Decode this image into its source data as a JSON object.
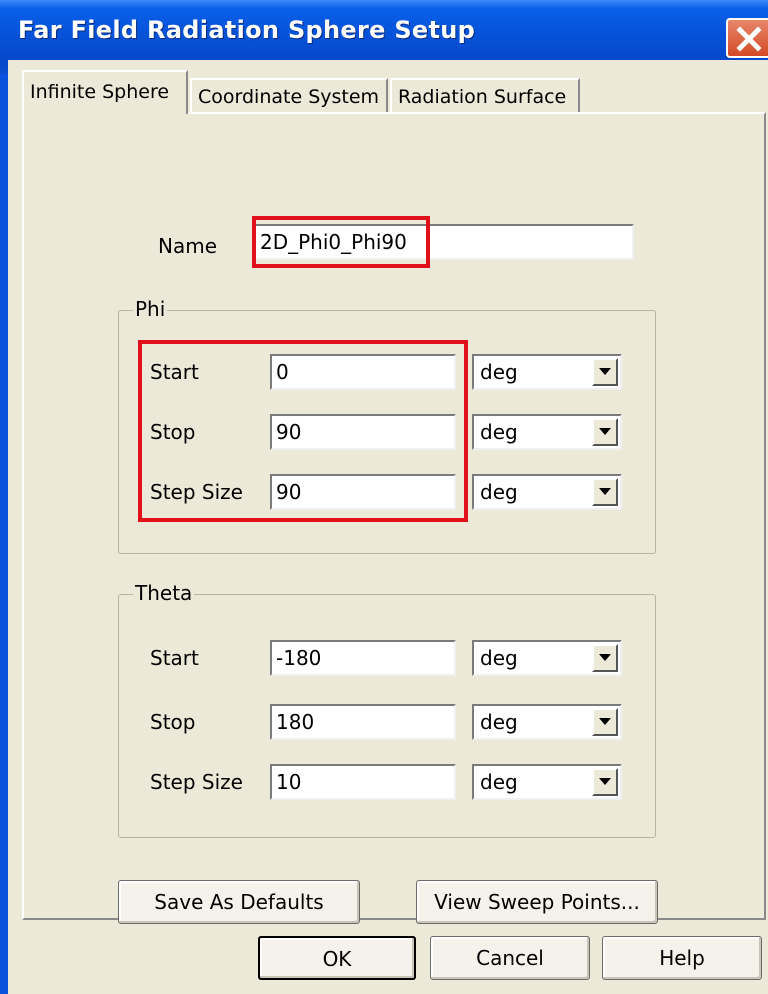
{
  "window": {
    "title": "Far Field Radiation Sphere Setup"
  },
  "tabs": [
    {
      "label": "Infinite Sphere",
      "active": true
    },
    {
      "label": "Coordinate System",
      "active": false
    },
    {
      "label": "Radiation Surface",
      "active": false
    }
  ],
  "name_field": {
    "label": "Name",
    "value": "2D_Phi0_Phi90"
  },
  "phi": {
    "title": "Phi",
    "rows": [
      {
        "label": "Start",
        "value": "0",
        "unit": "deg"
      },
      {
        "label": "Stop",
        "value": "90",
        "unit": "deg"
      },
      {
        "label": "Step Size",
        "value": "90",
        "unit": "deg"
      }
    ]
  },
  "theta": {
    "title": "Theta",
    "rows": [
      {
        "label": "Start",
        "value": "-180",
        "unit": "deg"
      },
      {
        "label": "Stop",
        "value": "180",
        "unit": "deg"
      },
      {
        "label": "Step Size",
        "value": "10",
        "unit": "deg"
      }
    ]
  },
  "buttons": {
    "save_defaults": "Save As Defaults",
    "view_sweep": "View Sweep Points...",
    "ok": "OK",
    "cancel": "Cancel",
    "help": "Help"
  },
  "colors": {
    "titlebar": "#0a52dd",
    "dialog_bg": "#ece9d8",
    "highlight": "#e2101a",
    "close": "#d44a26"
  }
}
